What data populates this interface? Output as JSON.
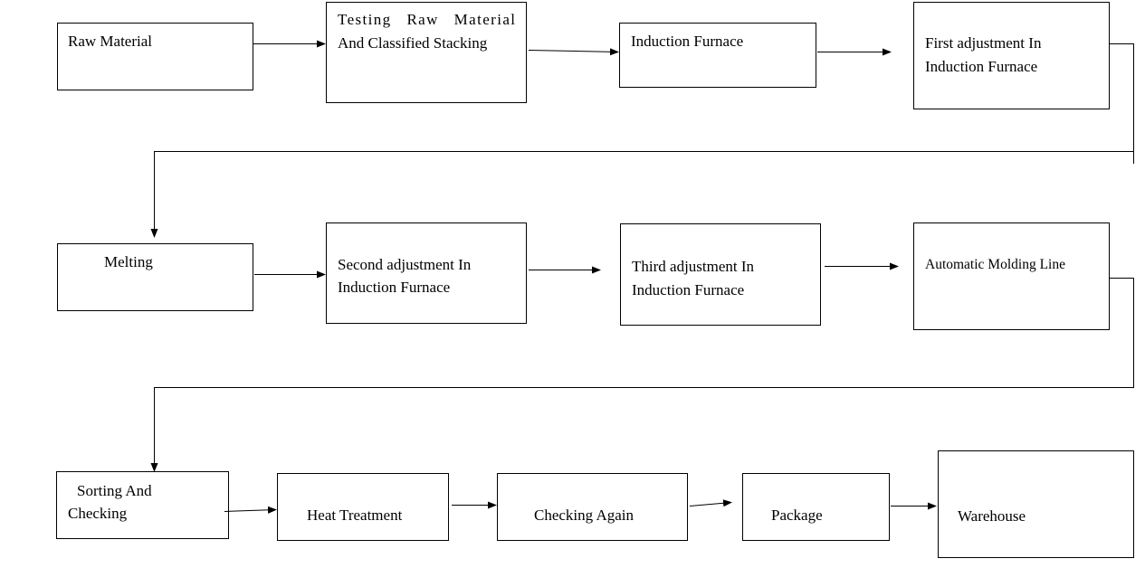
{
  "diagram": {
    "nodes": [
      {
        "id": "raw-material",
        "lines": [
          "Raw Material"
        ]
      },
      {
        "id": "testing",
        "lines": [
          "Testing   Raw   Material",
          "And Classified Stacking"
        ]
      },
      {
        "id": "induction-furnace",
        "lines": [
          "Induction Furnace"
        ]
      },
      {
        "id": "first-adjustment",
        "lines": [
          "First adjustment In",
          "Induction Furnace"
        ]
      },
      {
        "id": "melting",
        "lines": [
          "Melting"
        ]
      },
      {
        "id": "second-adjustment",
        "lines": [
          "Second adjustment In",
          "Induction Furnace"
        ]
      },
      {
        "id": "third-adjustment",
        "lines": [
          "Third adjustment In",
          "Induction Furnace"
        ]
      },
      {
        "id": "automatic-molding",
        "lines": [
          "Automatic Molding Line"
        ]
      },
      {
        "id": "sorting",
        "lines": [
          "Sorting And",
          "Checking"
        ]
      },
      {
        "id": "heat-treatment",
        "lines": [
          "Heat Treatment"
        ]
      },
      {
        "id": "checking-again",
        "lines": [
          "Checking Again"
        ]
      },
      {
        "id": "package",
        "lines": [
          "Package"
        ]
      },
      {
        "id": "warehouse",
        "lines": [
          "Warehouse"
        ]
      }
    ],
    "edges": [
      [
        "raw-material",
        "testing"
      ],
      [
        "testing",
        "induction-furnace"
      ],
      [
        "induction-furnace",
        "first-adjustment"
      ],
      [
        "first-adjustment",
        "melting"
      ],
      [
        "melting",
        "second-adjustment"
      ],
      [
        "second-adjustment",
        "third-adjustment"
      ],
      [
        "third-adjustment",
        "automatic-molding"
      ],
      [
        "automatic-molding",
        "sorting"
      ],
      [
        "sorting",
        "heat-treatment"
      ],
      [
        "heat-treatment",
        "checking-again"
      ],
      [
        "checking-again",
        "package"
      ],
      [
        "package",
        "warehouse"
      ]
    ]
  }
}
